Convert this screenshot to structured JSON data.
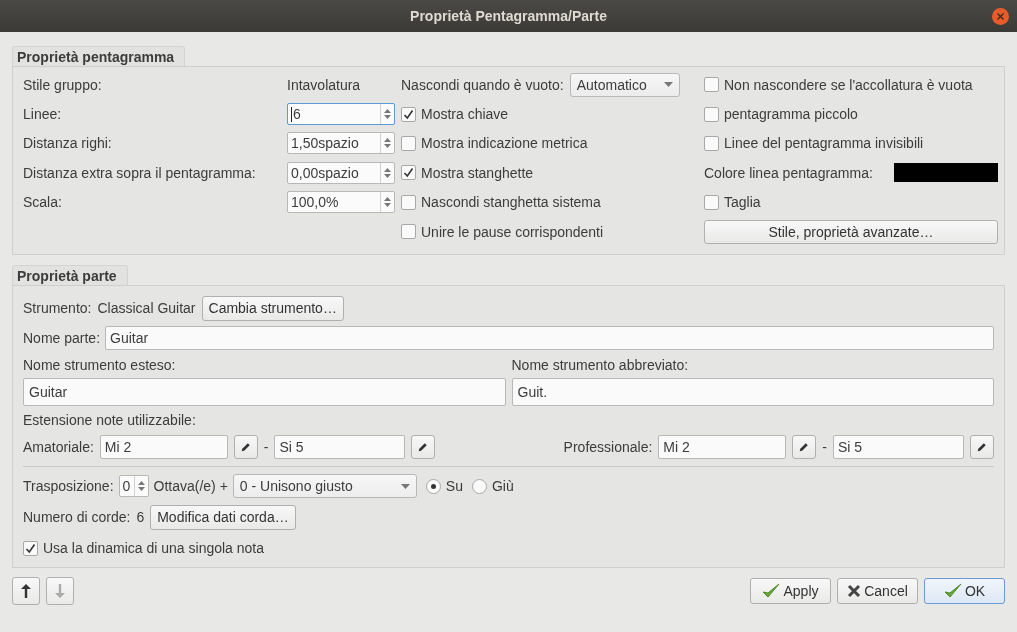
{
  "window": {
    "title": "Proprietà Pentagramma/Parte"
  },
  "staff": {
    "title": "Proprietà pentagramma",
    "group_style": {
      "label": "Stile gruppo:",
      "value": "Intavolatura"
    },
    "fields": [
      {
        "label": "Linee:",
        "value": "6",
        "focused": true
      },
      {
        "label": "Distanza righi:",
        "value": "1,50spazio",
        "focused": false
      },
      {
        "label": "Distanza extra sopra il pentagramma:",
        "value": "0,00spazio",
        "focused": false
      },
      {
        "label": "Scala:",
        "value": "100,0%",
        "focused": false
      }
    ],
    "hide_when_empty": {
      "label": "Nascondi quando è vuoto:",
      "value": "Automatico"
    },
    "middle_options": [
      {
        "label": "Mostra chiave",
        "checked": true
      },
      {
        "label": "Mostra indicazione metrica",
        "checked": false
      },
      {
        "label": "Mostra stanghette",
        "checked": true
      },
      {
        "label": "Nascondi stanghetta sistema",
        "checked": false
      },
      {
        "label": "Unire le pause corrispondenti",
        "checked": false
      }
    ],
    "right_options": [
      {
        "kind": "checkbox",
        "label": "Non nascondere se l'accollatura è vuota",
        "checked": false
      },
      {
        "kind": "checkbox",
        "label": "pentagramma piccolo",
        "checked": false
      },
      {
        "kind": "checkbox",
        "label": "Linee del pentagramma invisibili",
        "checked": false
      },
      {
        "kind": "color",
        "label": "Colore linea pentagramma:",
        "color": "#000000"
      },
      {
        "kind": "checkbox",
        "label": "Taglia",
        "checked": false
      },
      {
        "kind": "button",
        "label": "Stile, proprietà avanzate…"
      }
    ]
  },
  "part": {
    "title": "Proprietà parte",
    "instrument": {
      "label": "Strumento:",
      "value": "Classical Guitar",
      "button": "Cambia strumento…"
    },
    "part_name": {
      "label": "Nome parte:",
      "value": "Guitar"
    },
    "long_name": {
      "label": "Nome strumento esteso:",
      "value": "Guitar"
    },
    "short_name": {
      "label": "Nome strumento abbreviato:",
      "value": "Guit."
    },
    "range_label": "Estensione note utilizzabile:",
    "ranges": [
      {
        "label": "Amatoriale:",
        "low": "Mi 2",
        "separator": "-",
        "high": "Si 5"
      },
      {
        "label": "Professionale:",
        "low": "Mi 2",
        "separator": "-",
        "high": "Si 5"
      }
    ],
    "transposition": {
      "label": "Trasposizione:",
      "octaves": "0",
      "octave_label": "Ottava(/e) +",
      "interval": "0 - Unisono giusto",
      "directions": [
        {
          "label": "Su",
          "selected": true
        },
        {
          "label": "Giù",
          "selected": false
        }
      ]
    },
    "strings": {
      "label": "Numero di corde:",
      "value": "6",
      "button": "Modifica dati corda…"
    },
    "single_note_dynamics": {
      "label": "Usa la dinamica di una singola nota",
      "checked": true
    }
  },
  "footer": {
    "move": [
      {
        "kind": "up",
        "disabled": false
      },
      {
        "kind": "down",
        "disabled": true
      }
    ],
    "buttons": [
      {
        "label": "Apply",
        "kind": "apply",
        "default": false
      },
      {
        "label": "Cancel",
        "kind": "cancel",
        "default": false
      },
      {
        "label": "OK",
        "kind": "ok",
        "default": true
      }
    ]
  }
}
